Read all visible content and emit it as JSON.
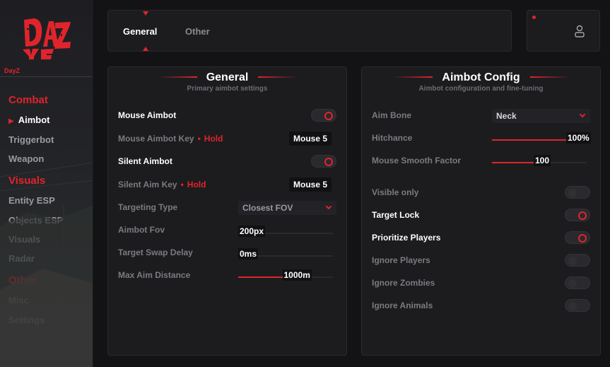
{
  "sidebar": {
    "logo_text": "DAYZ",
    "brand": "DayZ",
    "sections": [
      {
        "label": "Combat",
        "items": [
          {
            "label": "Aimbot",
            "active": true
          },
          {
            "label": "Triggerbot",
            "active": false
          },
          {
            "label": "Weapon",
            "active": false
          }
        ]
      },
      {
        "label": "Visuals",
        "items": [
          {
            "label": "Entity ESP",
            "active": false
          },
          {
            "label": "Objects ESP",
            "active": false
          },
          {
            "label": "Visuals",
            "active": false
          },
          {
            "label": "Radar",
            "active": false
          }
        ]
      },
      {
        "label": "Other",
        "items": [
          {
            "label": "Misc",
            "active": false
          },
          {
            "label": "Settings",
            "active": false
          }
        ]
      }
    ]
  },
  "tabs": [
    {
      "label": "General",
      "active": true
    },
    {
      "label": "Other",
      "active": false
    }
  ],
  "general": {
    "title": "General",
    "subtitle": "Primary aimbot settings",
    "mouse_aimbot": {
      "label": "Mouse Aimbot",
      "on": true
    },
    "mouse_aimbot_key": {
      "label": "Mouse Aimbot Key",
      "mode": "Hold",
      "key": "Mouse 5"
    },
    "silent_aimbot": {
      "label": "Silent Aimbot",
      "on": true
    },
    "silent_aim_key": {
      "label": "Silent Aim Key",
      "mode": "Hold",
      "key": "Mouse 5"
    },
    "targeting_type": {
      "label": "Targeting Type",
      "value": "Closest FOV"
    },
    "aimbot_fov": {
      "label": "Aimbot Fov",
      "value_text": "200px",
      "fraction": 0.05
    },
    "target_swap_delay": {
      "label": "Target Swap Delay",
      "value_text": "0ms",
      "fraction": 0.0
    },
    "max_aim_distance": {
      "label": "Max Aim Distance",
      "value_text": "1000m",
      "fraction": 0.62
    }
  },
  "aimbot": {
    "title": "Aimbot Config",
    "subtitle": "Aimbot configuration and fine-tuning",
    "aim_bone": {
      "label": "Aim Bone",
      "value": "Neck"
    },
    "hitchance": {
      "label": "Hitchance",
      "value_text": "100%",
      "fraction": 1.0
    },
    "mouse_smooth": {
      "label": "Mouse Smooth Factor",
      "value_text": "100",
      "fraction": 0.53
    },
    "toggles": [
      {
        "label": "Visible only",
        "on": false
      },
      {
        "label": "Target Lock",
        "on": true
      },
      {
        "label": "Prioritize Players",
        "on": true
      },
      {
        "label": "Ignore Players",
        "on": false
      },
      {
        "label": "Ignore Zombies",
        "on": false
      },
      {
        "label": "Ignore Animals",
        "on": false
      }
    ]
  },
  "colors": {
    "accent": "#e0242c",
    "panel": "#1c1c1f",
    "background": "#131315"
  }
}
